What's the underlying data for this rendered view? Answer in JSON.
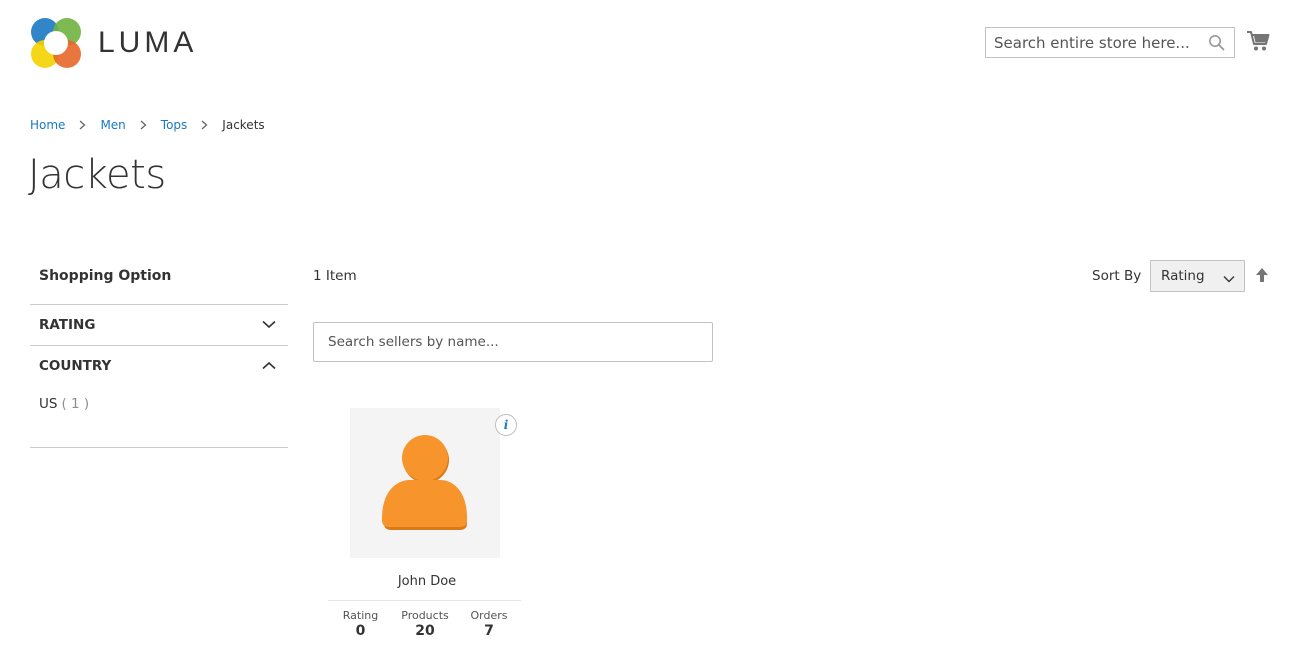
{
  "header": {
    "logo_text": "LUMA",
    "search_placeholder": "Search entire store here..."
  },
  "breadcrumbs": [
    {
      "label": "Home"
    },
    {
      "label": "Men"
    },
    {
      "label": "Tops"
    },
    {
      "label": "Jackets"
    }
  ],
  "page_title": "Jackets",
  "sidebar": {
    "title": "Shopping Option",
    "filters": [
      {
        "label": "RATING",
        "expanded": false
      },
      {
        "label": "COUNTRY",
        "expanded": true,
        "options": [
          {
            "label": "US",
            "count": "( 1 )"
          }
        ]
      }
    ]
  },
  "toolbar": {
    "item_count": "1 Item",
    "sort_label": "Sort By",
    "sort_value": "Rating"
  },
  "seller_search": {
    "placeholder": "Search sellers by name..."
  },
  "seller": {
    "info_badge": "i",
    "name": "John Doe",
    "stats": [
      {
        "label": "Rating",
        "value": "0"
      },
      {
        "label": "Products",
        "value": "20"
      },
      {
        "label": "Orders",
        "value": "7"
      }
    ]
  },
  "colors": {
    "link": "#1979c3",
    "avatar": "#f7952c",
    "border": "#c2c2c2"
  },
  "icons": {
    "search": "search-icon",
    "cart": "cart-icon",
    "chevron_down": "chevron-down-icon",
    "chevron_up": "chevron-up-icon",
    "sort_direction": "arrow-up-icon",
    "info": "info-icon",
    "avatar": "user-avatar-icon"
  }
}
